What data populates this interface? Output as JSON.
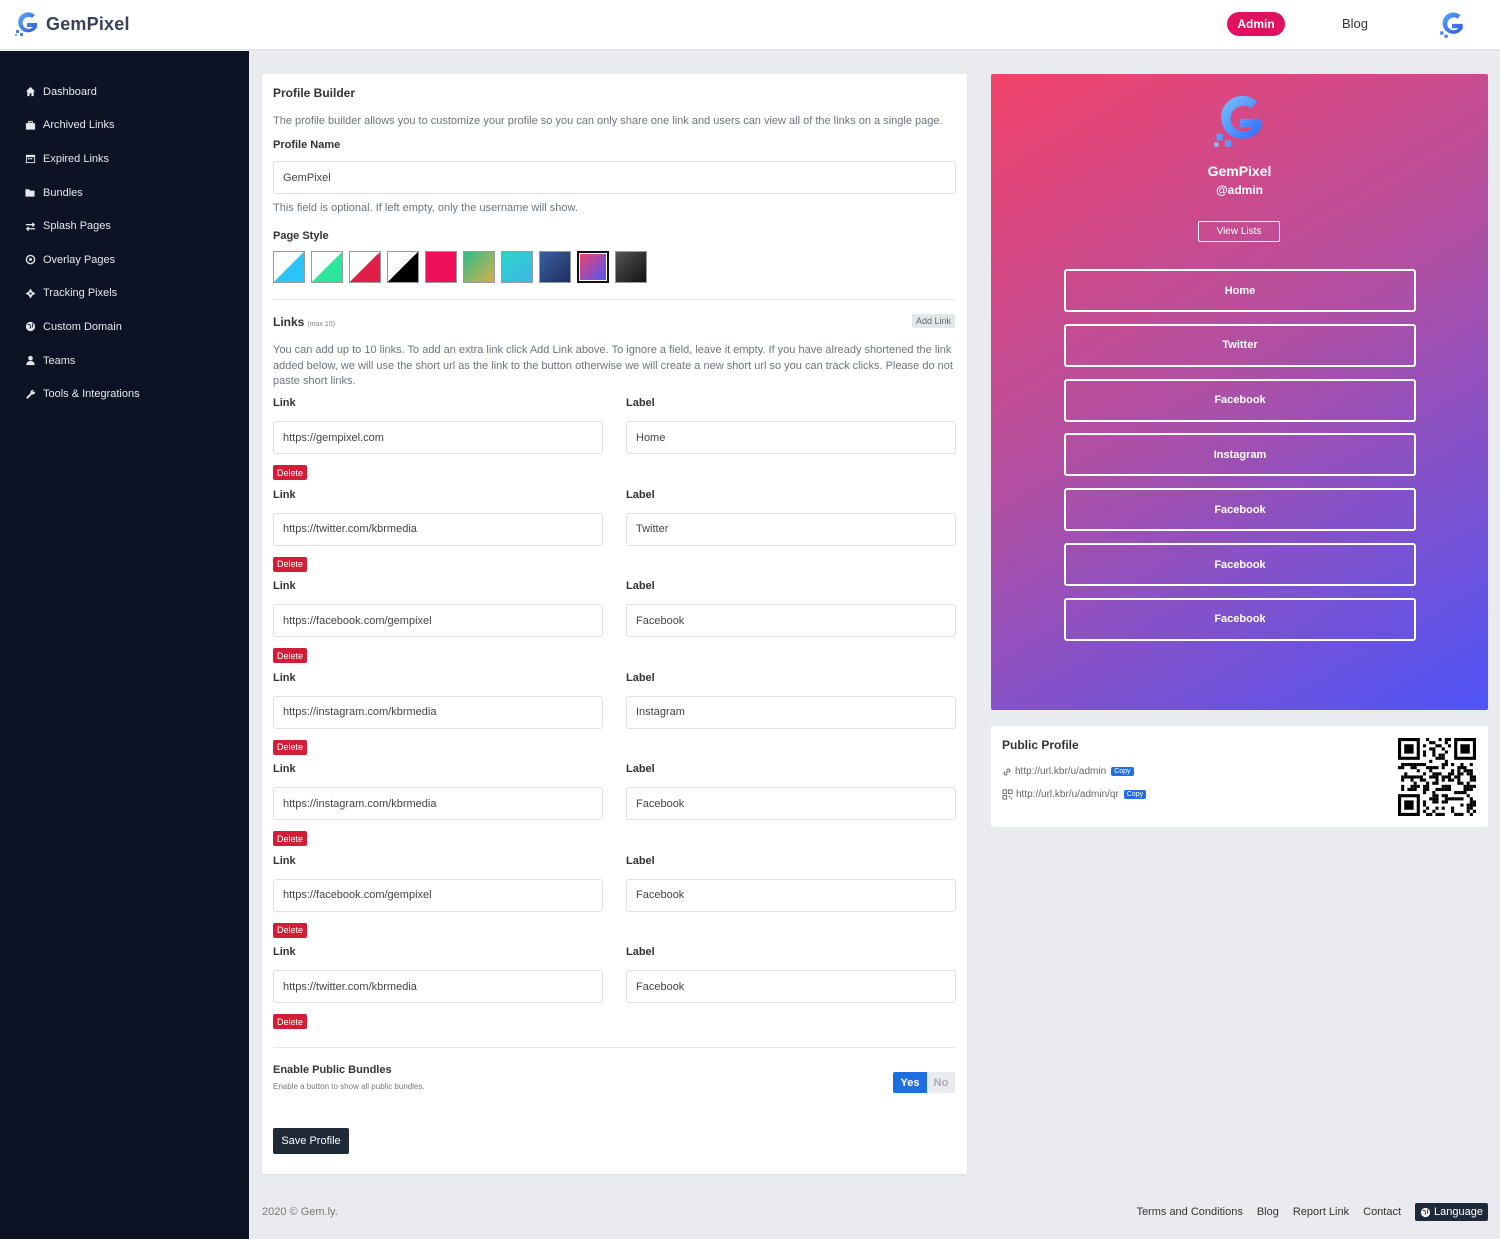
{
  "header": {
    "logo_text": "GemPixel",
    "admin_label": "Admin",
    "blog_label": "Blog"
  },
  "sidebar": {
    "items": [
      {
        "label": "Dashboard",
        "icon": "home-icon"
      },
      {
        "label": "Archived Links",
        "icon": "briefcase-icon"
      },
      {
        "label": "Expired Links",
        "icon": "calendar-icon"
      },
      {
        "label": "Bundles",
        "icon": "folder-icon"
      },
      {
        "label": "Splash Pages",
        "icon": "exchange-icon"
      },
      {
        "label": "Overlay Pages",
        "icon": "target-icon"
      },
      {
        "label": "Tracking Pixels",
        "icon": "crosshair-icon"
      },
      {
        "label": "Custom Domain",
        "icon": "globe-icon"
      },
      {
        "label": "Teams",
        "icon": "user-icon"
      },
      {
        "label": "Tools & Integrations",
        "icon": "wrench-icon"
      }
    ]
  },
  "builder": {
    "title": "Profile Builder",
    "description": "The profile builder allows you to customize your profile so you can only share one link and users can view all of the links on a single page.",
    "profile_name_label": "Profile Name",
    "profile_name_value": "GemPixel",
    "profile_name_help": "This field is optional. If left empty, only the username will show.",
    "page_style_label": "Page Style",
    "styles": [
      {
        "bg": "linear-gradient(135deg,#fff 50%,#29c5f6 50%)"
      },
      {
        "bg": "linear-gradient(135deg,#fff 50%,#2ee59d 50%)"
      },
      {
        "bg": "linear-gradient(135deg,#fff 50%,#e11d48 50%)"
      },
      {
        "bg": "linear-gradient(135deg,#fff 50%,#000 50%)"
      },
      {
        "bg": "#f0105a"
      },
      {
        "bg": "linear-gradient(135deg,#2fbf88,#d4b04a)"
      },
      {
        "bg": "linear-gradient(135deg,#2ad6c8,#3fb6e8)"
      },
      {
        "bg": "linear-gradient(135deg,#3a5fa0,#1e2e60)"
      },
      {
        "bg": "linear-gradient(135deg,#f2436b,#4e54f8)"
      },
      {
        "bg": "linear-gradient(135deg,#555,#111)"
      }
    ],
    "selected_style": 8,
    "links_label": "Links",
    "links_max": "(max 10)",
    "add_link_label": "Add Link",
    "links_help": "You can add up to 10 links. To add an extra link click Add Link above. To ignore a field, leave it empty. If you have already shortened the link added below, we will use the short url as the link to the button otherwise we will create a new short url so you can track clicks. Please do not paste short links.",
    "link_label": "Link",
    "label_label": "Label",
    "delete_label": "Delete",
    "links": [
      {
        "url": "https://gempixel.com",
        "label": "Home"
      },
      {
        "url": "https://twitter.com/kbrmedia",
        "label": "Twitter"
      },
      {
        "url": "https://facebook.com/gempixel",
        "label": "Facebook"
      },
      {
        "url": "https://instagram.com/kbrmedia",
        "label": "Instagram"
      },
      {
        "url": "https://instagram.com/kbrmedia",
        "label": "Facebook"
      },
      {
        "url": "https://facebook.com/gempixel",
        "label": "Facebook"
      },
      {
        "url": "https://twitter.com/kbrmedia",
        "label": "Facebook"
      }
    ],
    "bundles_title": "Enable Public Bundles",
    "bundles_help": "Enable a button to show all public bundles.",
    "yes_label": "Yes",
    "no_label": "No",
    "save_label": "Save Profile"
  },
  "preview": {
    "name": "GemPixel",
    "username": "@admin",
    "view_lists_label": "View Lists",
    "buttons": [
      "Home",
      "Twitter",
      "Facebook",
      "Instagram",
      "Facebook",
      "Facebook",
      "Facebook"
    ]
  },
  "public_profile": {
    "title": "Public Profile",
    "url": "http://url.kbr/u/admin",
    "qr_url": "http://url.kbr/u/admin/qr",
    "copy_label": "Copy"
  },
  "footer": {
    "copyright": "2020 © Gem.ly.",
    "links": [
      "Terms and Conditions",
      "Blog",
      "Report Link",
      "Contact"
    ],
    "language_label": "Language"
  }
}
